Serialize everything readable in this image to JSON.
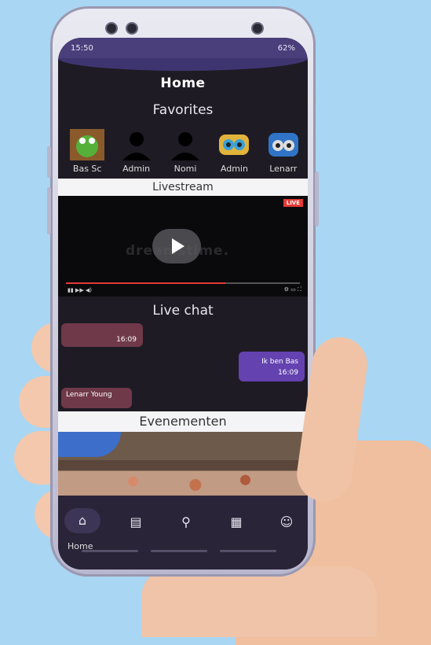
{
  "status": {
    "time": "15:50",
    "battery": "62%"
  },
  "header": {
    "title": "Home"
  },
  "favorites": {
    "title": "Favorites",
    "items": [
      {
        "name": "Bas Sc",
        "icon": "kermit-avatar"
      },
      {
        "name": "Admin",
        "icon": "person-icon"
      },
      {
        "name": "Nomi",
        "icon": "person-icon"
      },
      {
        "name": "Admin",
        "icon": "owl-avatar"
      },
      {
        "name": "Lenarr",
        "icon": "owl-avatar"
      }
    ]
  },
  "livestream": {
    "title": "Livestream",
    "badge": "LIVE",
    "watermark": "dreamstime."
  },
  "livechat": {
    "title": "Live chat",
    "messages": [
      {
        "side": "left",
        "text": "",
        "time": "16:09"
      },
      {
        "side": "right",
        "text": "Ik ben Bas",
        "time": "16:09"
      },
      {
        "side": "left",
        "text": "Lenarr Young",
        "time": ""
      }
    ]
  },
  "events": {
    "title": "Evenementen"
  },
  "nav": {
    "home_label": "Home",
    "items": [
      "home-icon",
      "chat-icon",
      "search-user-icon",
      "calendar-icon",
      "profile-icon"
    ]
  }
}
